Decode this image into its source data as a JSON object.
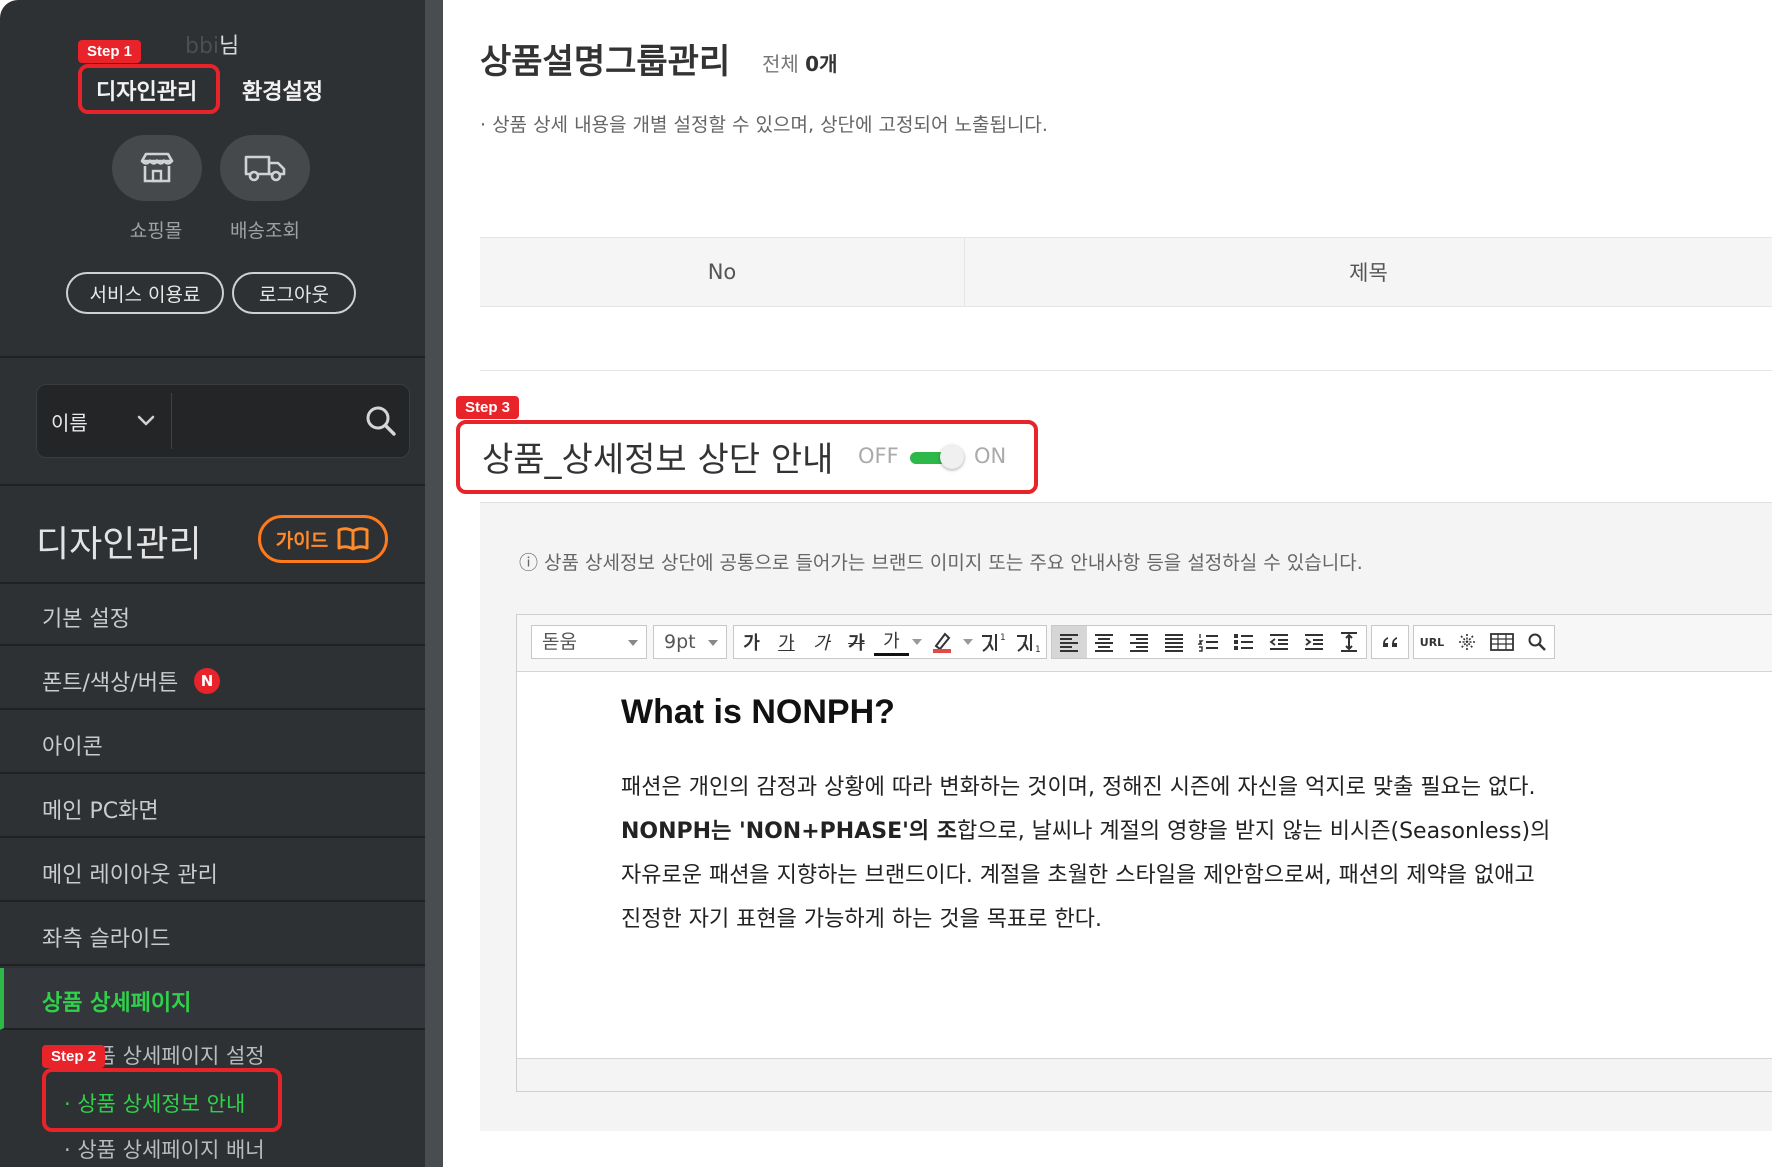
{
  "sidebar": {
    "user_name": "bbi",
    "user_suffix": "님",
    "top_links": [
      "디자인관리",
      "환경설정"
    ],
    "quick_buttons": [
      {
        "label": "쇼핑몰",
        "icon": "store-icon"
      },
      {
        "label": "배송조회",
        "icon": "truck-icon"
      }
    ],
    "pill_buttons": [
      "서비스 이용료",
      "로그아웃"
    ],
    "search": {
      "select_value": "이름",
      "placeholder": ""
    },
    "section_title": "디자인관리",
    "guide_label": "가이드",
    "menu": [
      {
        "label": "기본 설정"
      },
      {
        "label": "폰트/색상/버튼",
        "badge": "N"
      },
      {
        "label": "아이콘"
      },
      {
        "label": "메인 PC화면"
      },
      {
        "label": "메인 레이아웃 관리"
      },
      {
        "label": "좌측 슬라이드"
      },
      {
        "label": "상품 상세페이지"
      }
    ],
    "submenu": [
      {
        "label": "· 상품 상세페이지 설정"
      },
      {
        "label": "· 상품 상세정보 안내"
      },
      {
        "label": "· 상품 상세페이지 배너"
      }
    ]
  },
  "steps": [
    "Step 1",
    "Step 2",
    "Step 3"
  ],
  "main": {
    "title": "상품설명그룹관리",
    "count_prefix": "전체",
    "count_value": "0개",
    "description": "· 상품 상세 내용을 개별 설정할 수 있으며, 상단에 고정되어 노출됩니다.",
    "table_headers": [
      "No",
      "제목"
    ],
    "section_title": "상품_상세정보 상단 안내",
    "toggle_off": "OFF",
    "toggle_on": "ON",
    "toggle_state": "on",
    "notice": "ⓘ 상품 상세정보 상단에 공통으로 들어가는 브랜드 이미지 또는 주요 안내사항 등을 설정하실 수 있습니다.",
    "editor": {
      "font_value": "돋움",
      "size_value": "9pt",
      "format_buttons": [
        "가",
        "가",
        "가",
        "가",
        "가"
      ],
      "url_label": "URL",
      "content_heading": "What is NONPH?",
      "para1": "패션은 개인의 감정과 상황에 따라 변화하는 것이며, 정해진 시즌에 자신을 억지로 맞출 필요는 없다.",
      "para2_bold": "NONPH는 'NON+PHASE'의 조",
      "para2_rest": "합으로, 날씨나 계절의 영향을 받지 않는 비시즌(Seasonless)의",
      "para3": "자유로운 패션을 지향하는 브랜드이다. 계절을 초월한 스타일을 제안함으로써, 패션의 제약을 없애고",
      "para4": "진정한 자기 표현을 가능하게 하는 것을 목표로 한다."
    }
  },
  "colors": {
    "sidebar_bg": "#2e3133",
    "accent_green": "#2fd14b",
    "step_red": "#e8232a",
    "guide_orange": "#ff7a1a"
  }
}
